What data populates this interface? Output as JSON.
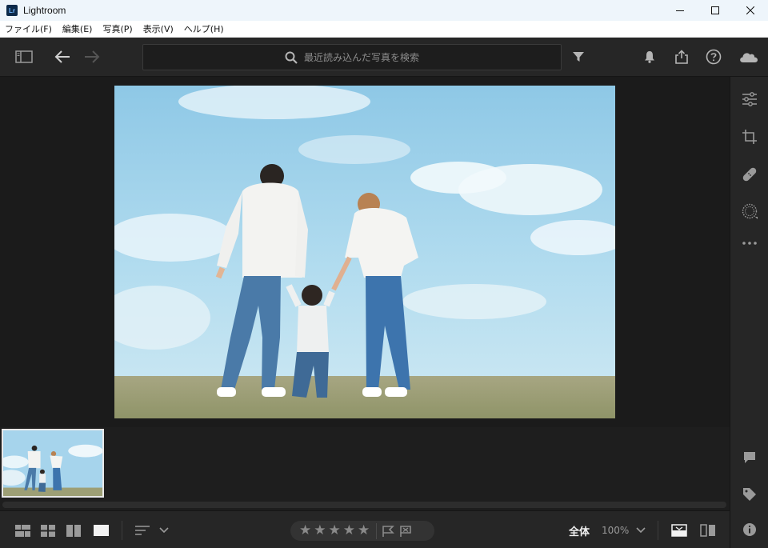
{
  "window": {
    "app_title": "Lightroom",
    "logo_text": "Lr"
  },
  "menu": {
    "items": [
      {
        "label": "ファイル(F)"
      },
      {
        "label": "編集(E)"
      },
      {
        "label": "写真(P)"
      },
      {
        "label": "表示(V)"
      },
      {
        "label": "ヘルプ(H)"
      }
    ]
  },
  "search": {
    "placeholder": "最近読み込んだ写真を検索"
  },
  "bottom": {
    "stars": [
      "★",
      "★",
      "★",
      "★",
      "★"
    ],
    "zoom_fit_label": "全体",
    "zoom_percent": "100%"
  },
  "colors": {
    "accent_logo": "#6fb6ff",
    "background": "#1b1b1b",
    "panel": "#262626"
  }
}
